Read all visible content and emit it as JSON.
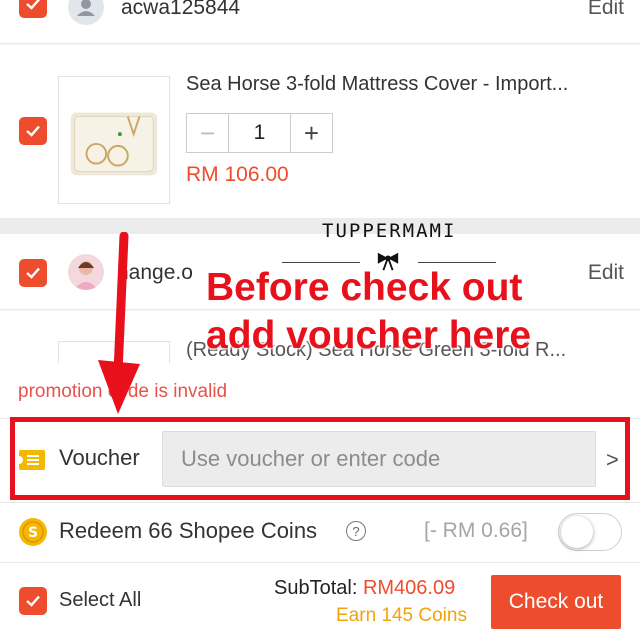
{
  "shop1": {
    "name": "acwa125844",
    "edit": "Edit"
  },
  "item1": {
    "title": "Sea Horse 3-fold Mattress Cover - Import...",
    "qty": "1",
    "minus": "−",
    "plus": "+",
    "price": "RM 106.00"
  },
  "shop2": {
    "name": "hange.o",
    "edit": "Edit"
  },
  "item2": {
    "title": "(Ready Stock) Sea Horse Green 3-fold R..."
  },
  "promo": {
    "message": "promotion code is invalid"
  },
  "voucher": {
    "label": "Voucher",
    "placeholder": "Use voucher or enter code",
    "chevron": ">"
  },
  "coins": {
    "label": "Redeem 66 Shopee Coins",
    "help": "?",
    "value": "[- RM 0.66]",
    "enabled": false
  },
  "footer": {
    "select_all": "Select All",
    "subtotal_label": "SubTotal: ",
    "subtotal_amount": "RM406.09",
    "earn": "Earn 145 Coins",
    "checkout": "Check out"
  },
  "annotation": {
    "brand": "TUPPERMAMI",
    "line1": "Before check out",
    "line2": "add voucher here"
  },
  "colors": {
    "accent": "#ee4d2d",
    "annotation": "#e8101b",
    "coins": "#f0a30a"
  }
}
